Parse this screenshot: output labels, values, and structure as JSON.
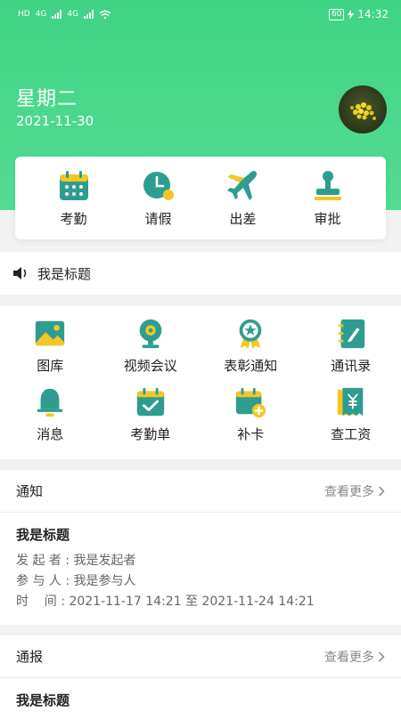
{
  "status_bar": {
    "left_tokens": [
      "HD",
      "4G",
      "4G"
    ],
    "battery": "60",
    "time": "14:32"
  },
  "header": {
    "weekday": "星期二",
    "date": "2021-11-30",
    "avatar_icon": "avatar-photo"
  },
  "quick_actions": [
    {
      "label": "考勤",
      "icon": "calendar-icon"
    },
    {
      "label": "请假",
      "icon": "clock-icon"
    },
    {
      "label": "出差",
      "icon": "airplane-icon"
    },
    {
      "label": "审批",
      "icon": "stamp-icon"
    }
  ],
  "notice_bar": {
    "icon": "speaker-icon",
    "text": "我是标题"
  },
  "features": [
    {
      "label": "图库",
      "icon": "picture-icon"
    },
    {
      "label": "视频会议",
      "icon": "webcam-icon"
    },
    {
      "label": "表彰通知",
      "icon": "award-icon"
    },
    {
      "label": "通讯录",
      "icon": "notebook-icon"
    },
    {
      "label": "消息",
      "icon": "bell-icon"
    },
    {
      "label": "考勤单",
      "icon": "calendar-check-icon"
    },
    {
      "label": "补卡",
      "icon": "calendar-plus-icon"
    },
    {
      "label": "查工资",
      "icon": "salary-icon"
    }
  ],
  "notices": {
    "title": "通知",
    "more": "查看更多",
    "item": {
      "title": "我是标题",
      "initiator_label": "发 起 者",
      "initiator": "我是发起者",
      "participant_label": "参 与 人",
      "participant": "我是参与人",
      "time_label": "时    间",
      "time_value": "2021-11-17 14:21 至 2021-11-24 14:21"
    }
  },
  "reports": {
    "title": "通报",
    "more": "查看更多",
    "item": {
      "title": "我是标题"
    }
  },
  "colors": {
    "brand_green": "#3fd383",
    "icon_teal": "#2e9d8f",
    "icon_yellow": "#f3c623"
  }
}
